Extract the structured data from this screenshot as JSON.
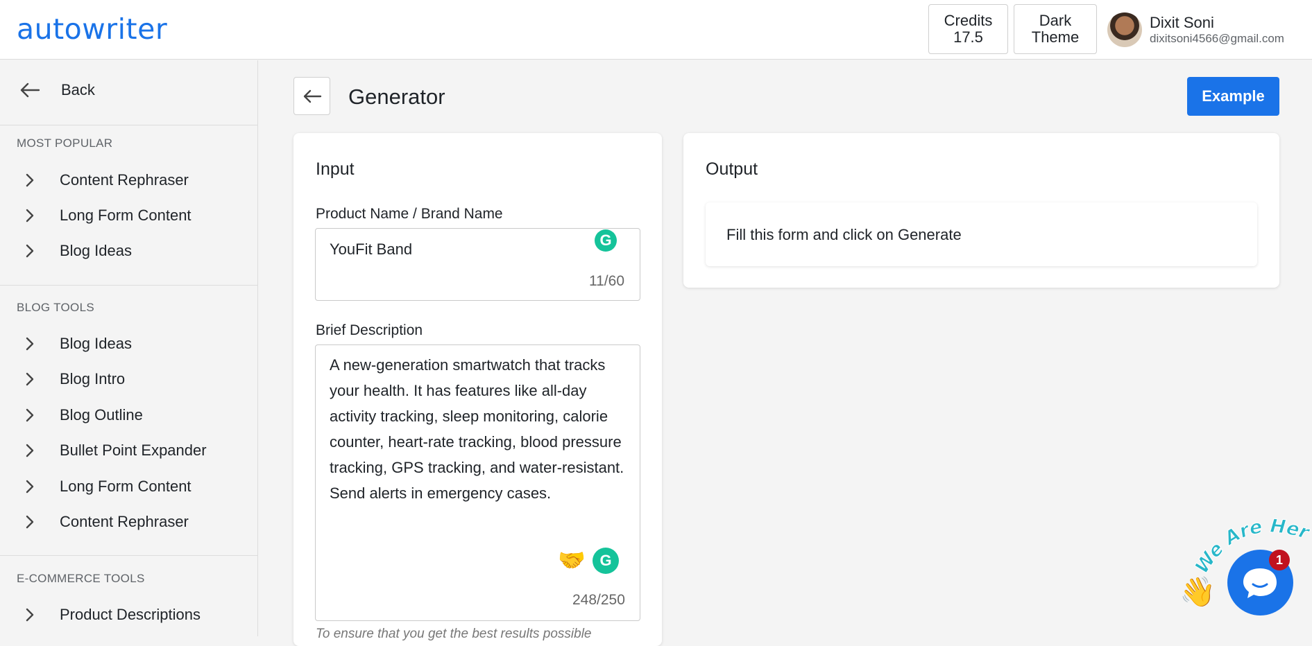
{
  "brand": {
    "logo": "autowriter"
  },
  "header": {
    "credits_label": "Credits",
    "credits_value": "17.5",
    "theme_label_1": "Dark",
    "theme_label_2": "Theme",
    "user_name": "Dixit Soni",
    "user_email": "dixitsoni4566@gmail.com"
  },
  "sidebar": {
    "back_label": "Back",
    "sections": [
      {
        "title": "MOST POPULAR",
        "items": [
          "Content Rephraser",
          "Long Form Content",
          "Blog Ideas"
        ]
      },
      {
        "title": "BLOG TOOLS",
        "items": [
          "Blog Ideas",
          "Blog Intro",
          "Blog Outline",
          "Bullet Point Expander",
          "Long Form Content",
          "Content Rephraser"
        ]
      },
      {
        "title": "E-COMMERCE TOOLS",
        "items": [
          "Product Descriptions"
        ]
      }
    ]
  },
  "main": {
    "title": "Generator",
    "example_label": "Example",
    "input": {
      "title": "Input",
      "product_label": "Product Name / Brand Name",
      "product_value": "YouFit Band",
      "product_count": "11/60",
      "desc_label": "Brief Description",
      "desc_lines": [
        "A new-generation smartwatch that tracks",
        "your health. It has features like all-day",
        "activity tracking, sleep monitoring, calorie",
        "counter, heart-rate tracking, blood pressure",
        "tracking, GPS tracking, and water-resistant.",
        "Send alerts in emergency cases."
      ],
      "desc_count": "248/250",
      "hint_partial": "To ensure that you get the best results possible"
    },
    "output": {
      "title": "Output",
      "placeholder": "Fill this form and click on Generate"
    }
  },
  "chat": {
    "badge": "1",
    "tagline": "We Are Here!"
  },
  "icons": {
    "back": "arrow-left-icon",
    "chevron": "chevron-right-icon",
    "grammarly": "grammarly-icon",
    "handshake": "handshake-icon",
    "wave": "waving-hand-icon",
    "chat": "chat-bubble-icon"
  },
  "colors": {
    "accent": "#1a73e8",
    "grammarly": "#15c39a",
    "badge": "#c1121f"
  }
}
